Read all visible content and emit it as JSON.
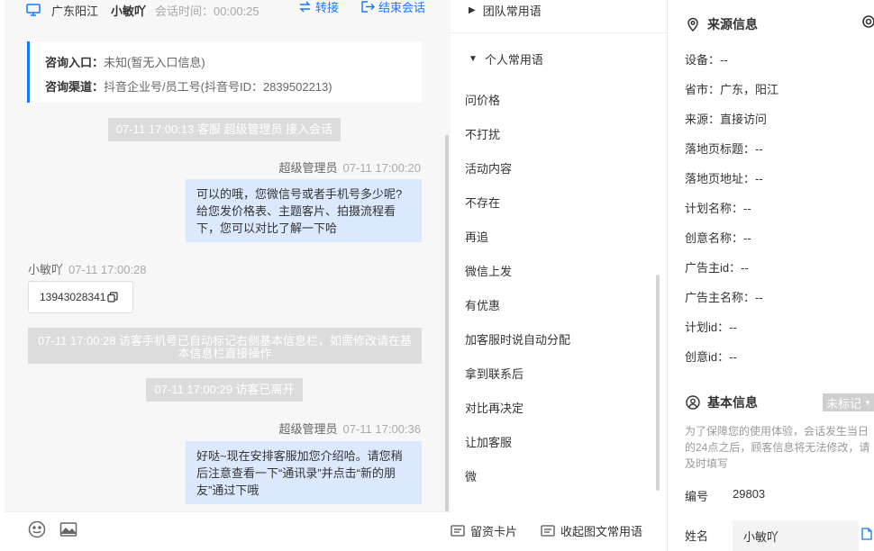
{
  "header": {
    "location": "广东阳江",
    "visitor_name": "小敏吖",
    "session_time": "会话时间：00:00:25",
    "transfer_label": "转接",
    "end_label": "结束会话"
  },
  "source_card": {
    "entry_key": "咨询入口：",
    "entry_value": "未知(暂无入口信息)",
    "channel_key": "咨询渠道：",
    "channel_value": "抖音企业号/员工号(抖音号ID：2839502213)"
  },
  "messages": {
    "sys1": "07-11 17:00:13 客服 超级管理员 接入会话",
    "agent1_name": "超级管理员",
    "agent1_time": "07-11 17:00:20",
    "agent1_text": "可以的哦，您微信号或者手机号多少呢?给您发价格表、主题客片、拍摄流程看下，您可以对比了解一下哈",
    "visitor_name": "小敏吖",
    "visitor_time": "07-11 17:00:28",
    "visitor_phone": "13943028341",
    "sys2": "07-11 17:00:28 访客手机号已自动标记右侧基本信息栏，如需修改请在基本信息栏直接操作",
    "sys3": "07-11 17:00:29 访客已离开",
    "agent2_name": "超级管理员",
    "agent2_time": "07-11 17:00:36",
    "agent2_text": "好哒~现在安排客服加您介绍哈。请您稍后注意查看一下“通讯录”并点击“新的朋友”通过下哦"
  },
  "phrases": {
    "team_group": "团队常用语",
    "personal_group": "个人常用语",
    "items": [
      "问价格",
      "不打扰",
      "活动内容",
      "不存在",
      "再追",
      "微信上发",
      "有优惠",
      "加客服时说自动分配",
      "拿到联系后",
      "对比再决定",
      "让加客服",
      "微"
    ],
    "leave_card": "留资卡片",
    "collapse": "收起图文常用语"
  },
  "source_info": {
    "title": "来源信息",
    "rows": [
      "设备：--",
      "省市：广东，阳江",
      "来源：直接访问",
      "落地页标题：--",
      "落地页地址：--",
      "计划名称：--",
      "创意名称：--",
      "广告主id：--",
      "广告主名称：--",
      "计划id：--",
      "创意id：--"
    ]
  },
  "basic_info": {
    "title": "基本信息",
    "tag": "未标记",
    "note": "为了保障您的使用体验，会话发生当日的24点之后，顾客信息将无法修改，请及时填写",
    "id_label": "编号",
    "id_value": "29803",
    "name_label": "姓名",
    "name_value": "小敏吖"
  }
}
